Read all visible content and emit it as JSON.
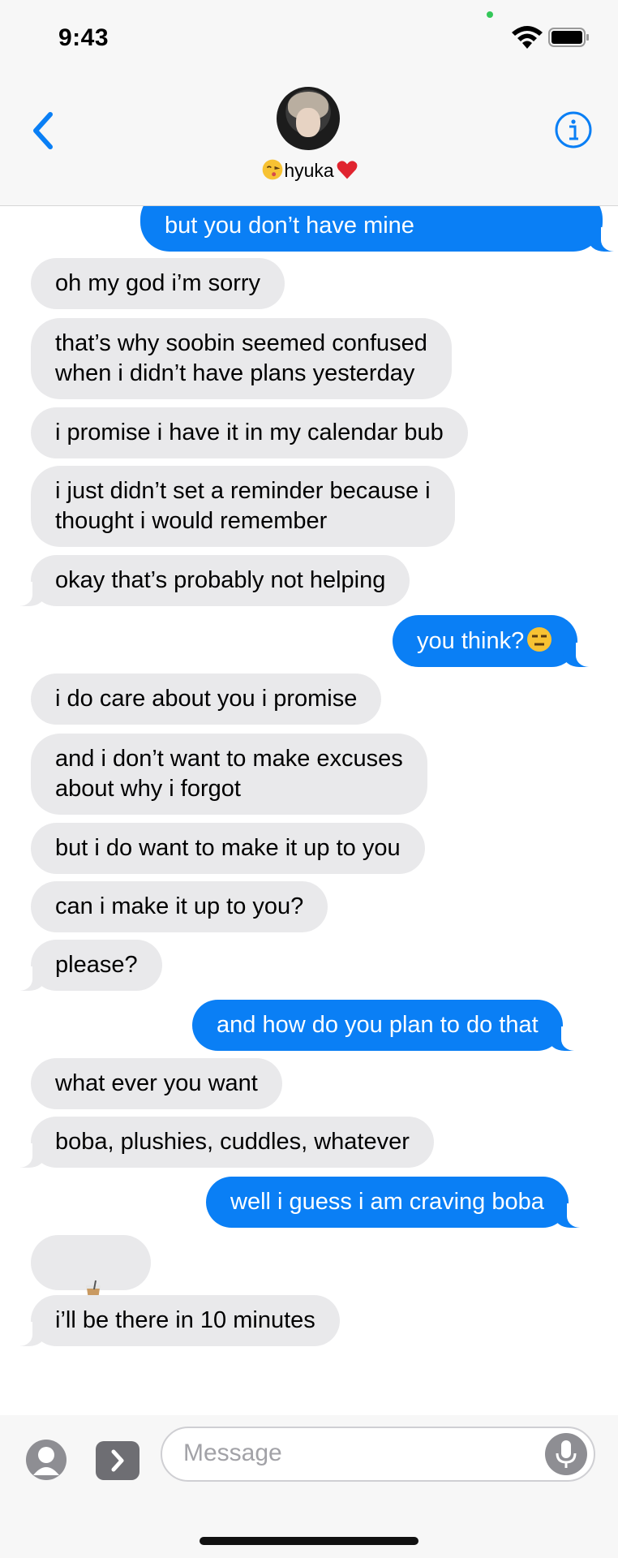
{
  "status_bar": {
    "time": "9:43"
  },
  "header": {
    "contact_name": "hyuka"
  },
  "messages": [
    {
      "side": "out",
      "text": "but you don’t have mine"
    },
    {
      "side": "in",
      "text": "oh my god i’m sorry"
    },
    {
      "side": "in",
      "text": "that’s why soobin seemed confused\nwhen i didn’t have plans yesterday"
    },
    {
      "side": "in",
      "text": "i promise i have it in my calendar bub"
    },
    {
      "side": "in",
      "text": "i just didn’t set a reminder because i\nthought i would remember"
    },
    {
      "side": "in",
      "text": "okay that’s probably not helping"
    },
    {
      "side": "out",
      "text": "you think?"
    },
    {
      "side": "in",
      "text": "i do care about you i promise"
    },
    {
      "side": "in",
      "text": "and i don’t want to make excuses\nabout why i forgot"
    },
    {
      "side": "in",
      "text": "but i do want to make it up to you"
    },
    {
      "side": "in",
      "text": "can i make it up to you?"
    },
    {
      "side": "in",
      "text": "please?"
    },
    {
      "side": "out",
      "text": "and how do you plan to do that"
    },
    {
      "side": "in",
      "text": "what ever you want"
    },
    {
      "side": "in",
      "text": "boba, plushies, cuddles, whatever"
    },
    {
      "side": "out",
      "text": "well i guess i am craving boba"
    },
    {
      "side": "in",
      "text": "",
      "icons": [
        "bubble-tea-icon",
        "running-person-icon"
      ]
    },
    {
      "side": "in",
      "text": "i’ll be there in 10 minutes"
    }
  ],
  "input_bar": {
    "placeholder": "Message"
  },
  "colors": {
    "outgoing": "#0a7ff5",
    "incoming": "#e9e9eb",
    "accent": "#0a7ff5"
  }
}
